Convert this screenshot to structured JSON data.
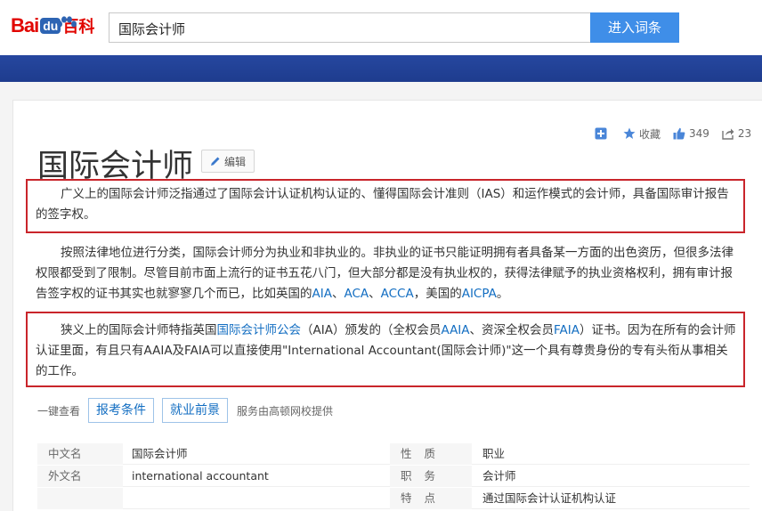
{
  "header": {
    "logo": {
      "bai": "Bai",
      "du": "du",
      "baike": "百科"
    },
    "search_value": "国际会计师",
    "search_button": "进入词条"
  },
  "toolbar": {
    "collect_label": "收藏",
    "like_count": "349",
    "share_count": "23"
  },
  "entry": {
    "title": "国际会计师",
    "edit_label": "编辑"
  },
  "paragraphs": {
    "p1": "广义上的国际会计师泛指通过了国际会计认证机构认证的、懂得国际会计准则（IAS）和运作模式的会计师，具备国际审计报告的签字权。",
    "p2_text": "按照法律地位进行分类，国际会计师分为执业和非执业的。非执业的证书只能证明拥有者具备某一方面的出色资历，但很多法律权限都受到了限制。尽管目前市面上流行的证书五花八门，但大部分都是没有执业权的，获得法律赋予的执业资格权利，拥有审计报告签字权的证书其实也就寥寥几个而已，比如英国的",
    "p2_link1": "AIA",
    "p2_sep1": "、",
    "p2_link2": "ACA",
    "p2_sep2": "、",
    "p2_link3": "ACCA",
    "p2_mid": "，美国的",
    "p2_link4": "AICPA",
    "p2_end": "。",
    "p3_a": "狭义上的国际会计师特指英国",
    "p3_link1": "国际会计师公会",
    "p3_b": "（AIA）颁发的（全权会员",
    "p3_link2": "AAIA",
    "p3_c": "、资深全权会员",
    "p3_link3": "FAIA",
    "p3_d": "）证书。因为在所有的会计师认证里面，有且只有AAIA及FAIA可以直接使用\"International Accountant(国际会计师)\"这一个具有尊贵身份的专有头衔从事相关的工作。"
  },
  "quick": {
    "label": "一键查看",
    "btn1": "报考条件",
    "btn2": "就业前景",
    "provider": "服务由高顿网校提供"
  },
  "infobox": [
    {
      "l1": "中文名",
      "v1": "国际会计师",
      "l2": "性质",
      "v2": "职业"
    },
    {
      "l1": "外文名",
      "v1": "international accountant",
      "l2": "职务",
      "v2": "会计师"
    },
    {
      "l1": "",
      "v1": "",
      "l2": "特点",
      "v2": "通过国际会计认证机构认证"
    }
  ],
  "colors": {
    "brand_red": "#e10601",
    "brand_blue": "#2d64b3",
    "link": "#136ec2",
    "highlight_box": "#c9252b",
    "search_button": "#3f8ee8"
  }
}
